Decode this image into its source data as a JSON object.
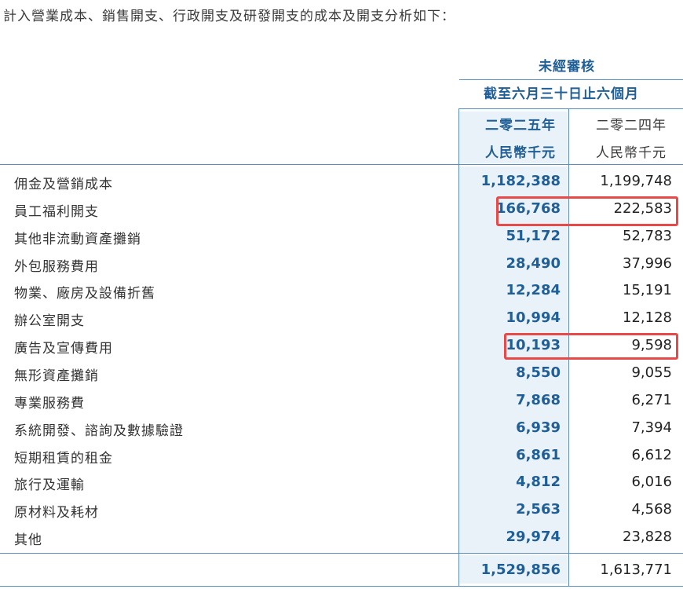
{
  "intro": "計入營業成本、銷售開支、行政開支及研發開支的成本及開支分析如下：",
  "header": {
    "audit_status": "未經審核",
    "period": "截至六月三十日止六個月",
    "year_2025": "二零二五年",
    "year_2024": "二零二四年",
    "unit_2025": "人民幣千元",
    "unit_2024": "人民幣千元"
  },
  "rows": [
    {
      "label": "佣金及營銷成本",
      "y2025": "1,182,388",
      "y2024": "1,199,748"
    },
    {
      "label": "員工福利開支",
      "y2025": "166,768",
      "y2024": "222,583"
    },
    {
      "label": "其他非流動資產攤銷",
      "y2025": "51,172",
      "y2024": "52,783"
    },
    {
      "label": "外包服務費用",
      "y2025": "28,490",
      "y2024": "37,996"
    },
    {
      "label": "物業、廠房及設備折舊",
      "y2025": "12,284",
      "y2024": "15,191"
    },
    {
      "label": "辦公室開支",
      "y2025": "10,994",
      "y2024": "12,128"
    },
    {
      "label": "廣告及宣傳費用",
      "y2025": "10,193",
      "y2024": "9,598"
    },
    {
      "label": "無形資產攤銷",
      "y2025": "8,550",
      "y2024": "9,055"
    },
    {
      "label": "專業服務費",
      "y2025": "7,868",
      "y2024": "6,271"
    },
    {
      "label": "系統開發、諮詢及數據驗證",
      "y2025": "6,939",
      "y2024": "7,394"
    },
    {
      "label": "短期租賃的租金",
      "y2025": "6,861",
      "y2024": "6,612"
    },
    {
      "label": "旅行及運輸",
      "y2025": "4,812",
      "y2024": "6,016"
    },
    {
      "label": "原材料及耗材",
      "y2025": "2,563",
      "y2024": "4,568"
    },
    {
      "label": "其他",
      "y2025": "29,974",
      "y2024": "23,828"
    }
  ],
  "total": {
    "y2025": "1,529,856",
    "y2024": "1,613,771"
  },
  "colors": {
    "accent_blue": "#1f5f95",
    "highlight_red": "#e84a4a",
    "band_blue": "#eaf2f9"
  }
}
